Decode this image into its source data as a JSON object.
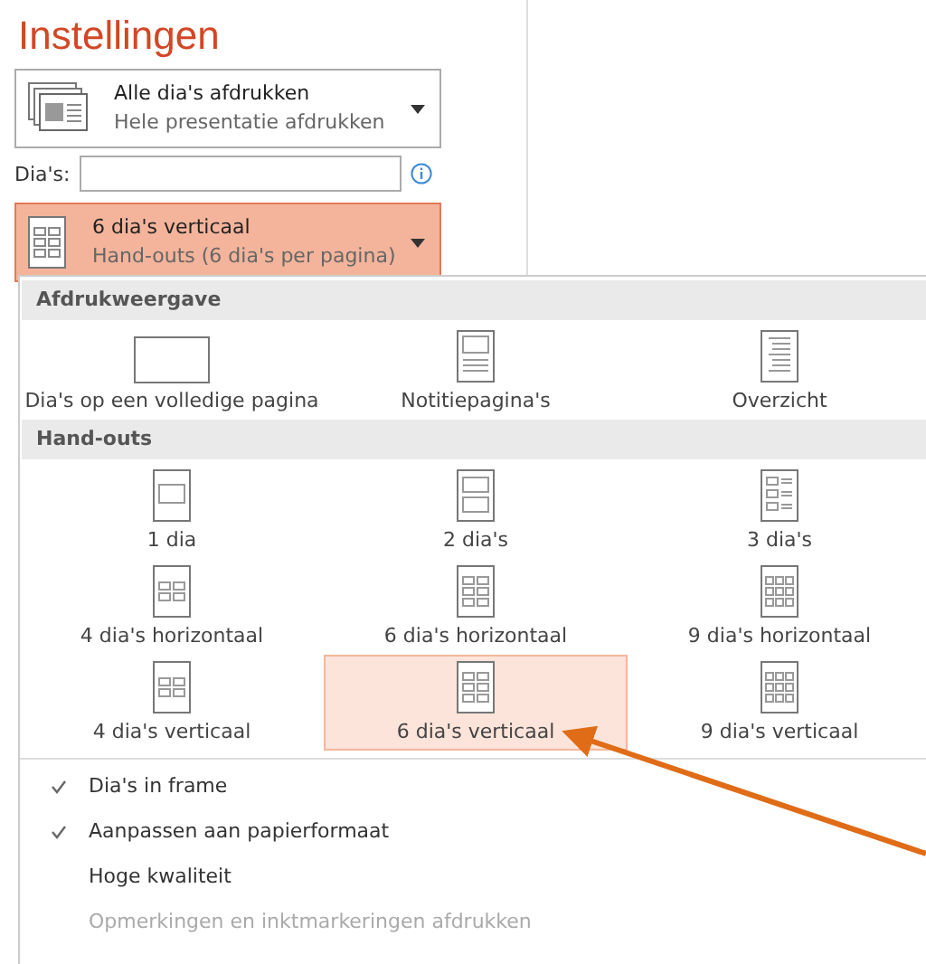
{
  "title": "Instellingen",
  "slides_dropdown": {
    "label": "Alle dia's afdrukken",
    "sublabel": "Hele presentatie afdrukken"
  },
  "slides_field": {
    "label": "Dia's:"
  },
  "layout_dropdown": {
    "label": "6 dia's verticaal",
    "sublabel": "Hand-outs (6 dia's per pagina)",
    "selected": true
  },
  "sections": [
    {
      "heading": "Afdrukweergave",
      "items": [
        {
          "label": "Dia's op een volledige pagina",
          "kind": "full",
          "selected": false
        },
        {
          "label": "Notitiepagina's",
          "kind": "notes",
          "selected": false
        },
        {
          "label": "Overzicht",
          "kind": "outline",
          "selected": false
        }
      ]
    },
    {
      "heading": "Hand-outs",
      "items": [
        {
          "label": "1 dia",
          "kind": "one",
          "selected": false
        },
        {
          "label": "2 dia's",
          "kind": "two",
          "selected": false
        },
        {
          "label": "3 dia's",
          "kind": "three",
          "selected": false
        },
        {
          "label": "4 dia's horizontaal",
          "kind": "four",
          "selected": false
        },
        {
          "label": "6 dia's horizontaal",
          "kind": "six",
          "selected": false
        },
        {
          "label": "9 dia's horizontaal",
          "kind": "nine",
          "selected": false
        },
        {
          "label": "4 dia's verticaal",
          "kind": "four",
          "selected": false
        },
        {
          "label": "6 dia's verticaal",
          "kind": "six",
          "selected": true
        },
        {
          "label": "9 dia's verticaal",
          "kind": "nine",
          "selected": false
        }
      ]
    }
  ],
  "options": [
    {
      "label": "Dia's in frame",
      "checked": true,
      "disabled": false
    },
    {
      "label": "Aanpassen aan papierformaat",
      "checked": true,
      "disabled": false
    },
    {
      "label": "Hoge kwaliteit",
      "checked": false,
      "disabled": false
    },
    {
      "label": "Opmerkingen en inktmarkeringen afdrukken",
      "checked": false,
      "disabled": true
    }
  ]
}
